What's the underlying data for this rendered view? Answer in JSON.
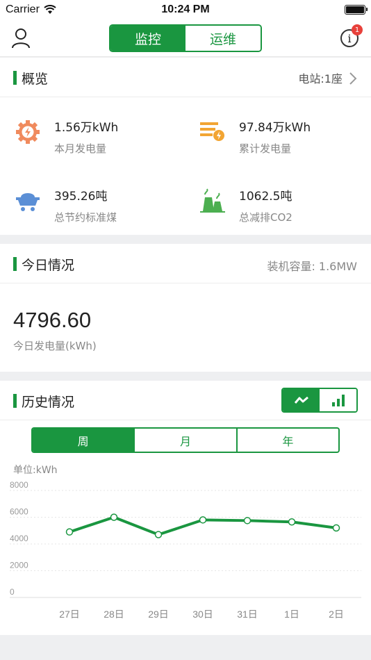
{
  "status_bar": {
    "carrier": "Carrier",
    "time": "10:24 PM"
  },
  "nav": {
    "tabs": [
      {
        "label": "监控",
        "active": true
      },
      {
        "label": "运维",
        "active": false
      }
    ],
    "badge_count": "1",
    "info_glyph": "i"
  },
  "overview": {
    "title": "概览",
    "station": "电站:1座",
    "stats": [
      {
        "value": "1.56万kWh",
        "label": "本月发电量",
        "icon": "gear-lightning-icon",
        "color": "#f08a5d"
      },
      {
        "value": "97.84万kWh",
        "label": "累计发电量",
        "icon": "stack-lightning-icon",
        "color": "#f2a533"
      },
      {
        "value": "395.26吨",
        "label": "总节约标准煤",
        "icon": "coal-cart-icon",
        "color": "#5b8fd6"
      },
      {
        "value": "1062.5吨",
        "label": "总减排CO2",
        "icon": "cooling-tower-icon",
        "color": "#4caf50"
      }
    ]
  },
  "today": {
    "title": "今日情况",
    "capacity": "装机容量: 1.6MW",
    "value": "4796.60",
    "label": "今日发电量(kWh)"
  },
  "history": {
    "title": "历史情况",
    "periods": [
      {
        "label": "周",
        "active": true
      },
      {
        "label": "月",
        "active": false
      },
      {
        "label": "年",
        "active": false
      }
    ],
    "unit": "单位:kWh",
    "colors": {
      "accent": "#1a9640"
    }
  },
  "chart_data": {
    "type": "line",
    "categories": [
      "27日",
      "28日",
      "29日",
      "30日",
      "31日",
      "1日",
      "2日"
    ],
    "values": [
      4900,
      6000,
      4700,
      5800,
      5750,
      5650,
      5200
    ],
    "ylim": [
      0,
      8000
    ],
    "yticks": [
      "0",
      "2000",
      "4000",
      "6000",
      "8000"
    ],
    "grid": true,
    "legend": "none"
  }
}
